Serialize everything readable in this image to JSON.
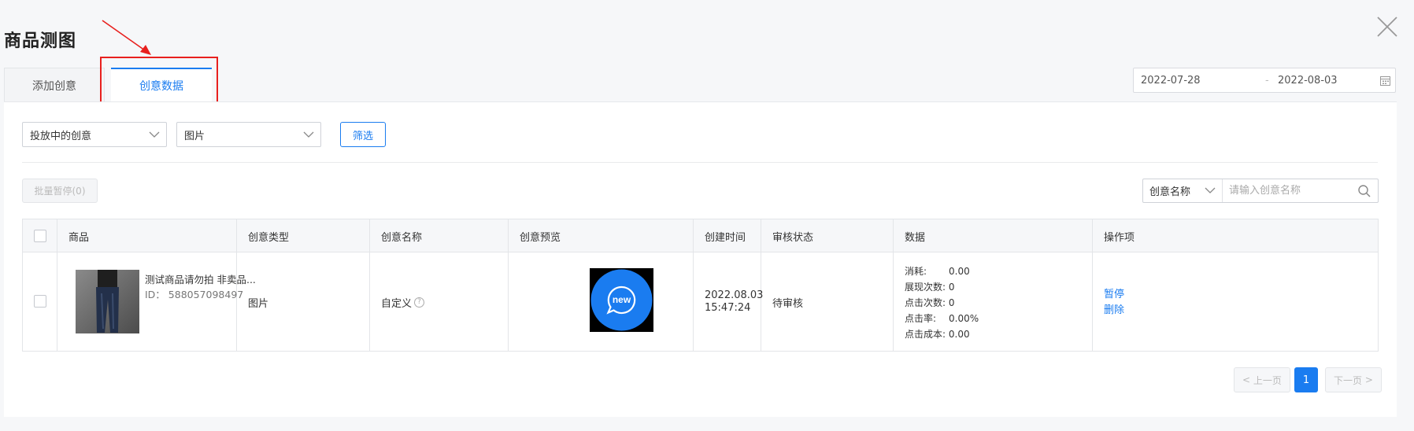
{
  "modal": {
    "title": "商品测图"
  },
  "tabs": [
    {
      "label": "添加创意",
      "active": false
    },
    {
      "label": "创意数据",
      "active": true
    }
  ],
  "date_range": {
    "start": "2022-07-28",
    "separator": "-",
    "end": "2022-08-03"
  },
  "filters": {
    "status_select": "投放中的创意",
    "type_select": "图片",
    "filter_button": "筛选"
  },
  "toolbar": {
    "batch_pause": "批量暂停(0)",
    "search_type": "创意名称",
    "search_placeholder": "请输入创意名称"
  },
  "table": {
    "headers": [
      "商品",
      "创意类型",
      "创意名称",
      "创意预览",
      "创建时间",
      "审核状态",
      "数据",
      "操作项"
    ],
    "rows": [
      {
        "product_name": "测试商品请勿拍 非卖品...",
        "product_id": "ID： 588057098497",
        "creative_type": "图片",
        "creative_name": "自定义",
        "preview_text": "new",
        "created_date": "2022.08.03",
        "created_time": "15:47:24",
        "review_status": "待审核",
        "stats": [
          {
            "key": "消耗:",
            "value": "0.00"
          },
          {
            "key": "展现次数:",
            "value": "0"
          },
          {
            "key": "点击次数:",
            "value": "0"
          },
          {
            "key": "点击率:",
            "value": "0.00%"
          },
          {
            "key": "点击成本:",
            "value": "0.00"
          }
        ],
        "actions": [
          "暂停",
          "删除"
        ]
      }
    ]
  },
  "pagination": {
    "prev": "上一页",
    "current": "1",
    "next": "下一页"
  },
  "colors": {
    "accent": "#1a7cf0",
    "annotation": "#e8201e",
    "preview_bg": "#1a7cf0"
  }
}
